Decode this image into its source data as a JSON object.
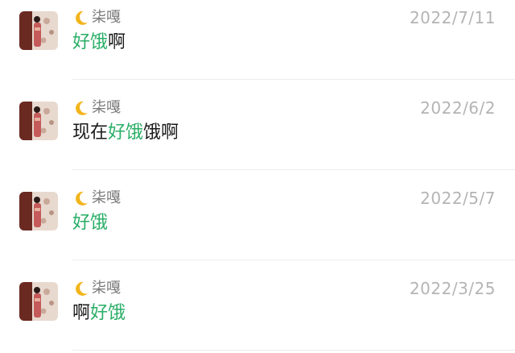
{
  "colors": {
    "highlight": "#2aae67",
    "text": "#1a1a1a",
    "sender": "#7a7a7a",
    "date": "#b4b4b4",
    "divider": "#ececec"
  },
  "results": [
    {
      "sender_icon": "crescent-moon-icon",
      "sender": "柒嘎",
      "date": "2022/7/11",
      "message_parts": [
        {
          "text": "好饿",
          "highlight": true
        },
        {
          "text": "啊",
          "highlight": false
        }
      ]
    },
    {
      "sender_icon": "crescent-moon-icon",
      "sender": "柒嘎",
      "date": "2022/6/2",
      "message_parts": [
        {
          "text": "现在",
          "highlight": false
        },
        {
          "text": "好饿",
          "highlight": true
        },
        {
          "text": "饿啊",
          "highlight": false
        }
      ]
    },
    {
      "sender_icon": "crescent-moon-icon",
      "sender": "柒嘎",
      "date": "2022/5/7",
      "message_parts": [
        {
          "text": "好饿",
          "highlight": true
        }
      ]
    },
    {
      "sender_icon": "crescent-moon-icon",
      "sender": "柒嘎",
      "date": "2022/3/25",
      "message_parts": [
        {
          "text": "啊",
          "highlight": false
        },
        {
          "text": "好饿",
          "highlight": true
        }
      ]
    }
  ]
}
